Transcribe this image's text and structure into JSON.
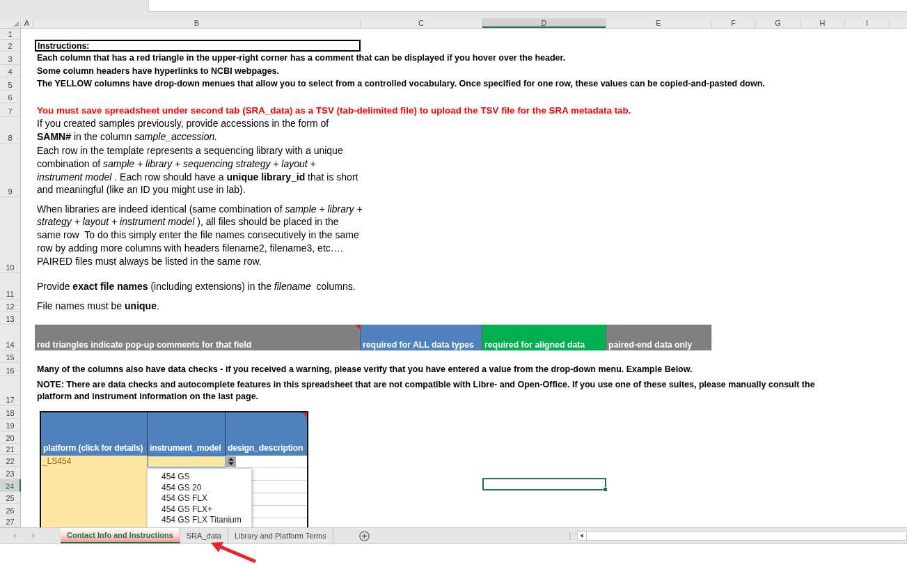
{
  "column_headers": [
    {
      "label": "A",
      "selected": false
    },
    {
      "label": "B",
      "selected": false
    },
    {
      "label": "C",
      "selected": false
    },
    {
      "label": "D",
      "selected": true
    },
    {
      "label": "E",
      "selected": false
    },
    {
      "label": "F",
      "selected": false
    },
    {
      "label": "G",
      "selected": false
    },
    {
      "label": "H",
      "selected": false
    },
    {
      "label": "I",
      "selected": false
    }
  ],
  "row_headers": [
    {
      "label": "1",
      "selected": false
    },
    {
      "label": "2",
      "selected": false
    },
    {
      "label": "3",
      "selected": false
    },
    {
      "label": "4",
      "selected": false
    },
    {
      "label": "5",
      "selected": false
    },
    {
      "label": "6",
      "selected": false
    },
    {
      "label": "7",
      "selected": false
    },
    {
      "label": "8",
      "selected": false
    },
    {
      "label": "9",
      "selected": false
    },
    {
      "label": "10",
      "selected": false
    },
    {
      "label": "11",
      "selected": false
    },
    {
      "label": "12",
      "selected": false
    },
    {
      "label": "13",
      "selected": false
    },
    {
      "label": "14",
      "selected": false
    },
    {
      "label": "15",
      "selected": false
    },
    {
      "label": "16",
      "selected": false
    },
    {
      "label": "17",
      "selected": false
    },
    {
      "label": "18",
      "selected": false
    },
    {
      "label": "19",
      "selected": false
    },
    {
      "label": "20",
      "selected": false
    },
    {
      "label": "21",
      "selected": false
    },
    {
      "label": "22",
      "selected": false
    },
    {
      "label": "23",
      "selected": false
    },
    {
      "label": "24",
      "selected": true
    },
    {
      "label": "25",
      "selected": false
    },
    {
      "label": "26",
      "selected": false
    },
    {
      "label": "27",
      "selected": false
    }
  ],
  "instructions": {
    "title": "Instructions:",
    "notes": [
      "Each column that has a red triangle in the upper-right corner has a comment that can be displayed if you hover over the header.",
      "Some column headers have hyperlinks to NCBI webpages.",
      "The YELLOW columns have drop-down menues that allow you to select from a controlled vocabulary. Once specified for one row, these values can be copied-and-pasted down."
    ],
    "warning": "You must save spreadsheet under second tab (SRA_data) as a TSV (tab-delimited file) to upload the TSV file for the SRA metadata tab.",
    "paragraphs": [
      "If you created samples previously, provide accessions in the form of **SAMN#** in the column *sample_accession.*",
      "Each row in the template represents a sequencing library with a unique combination of *sample + library + sequencing strategy + layout + instrument model* . Each row should have a **unique library_id** that is short and meaningful (like an ID you might use in lab).",
      "When libraries are indeed identical (same combination of *sample + library + strategy + layout + instrument model* ), all files should be placed in the same row  To do this simply enter the file names consecutively in the same row by adding more columns with headers filename2, filename3, etc…. PAIRED files must always be listed in the same row.",
      "Provide **exact file names** (including extensions) in the *filename*  columns.",
      "File names must be **unique**."
    ]
  },
  "legend": [
    {
      "text": "red triangles indicate pop-up comments for that field",
      "color": "#808080",
      "comment": true
    },
    {
      "text": "required for ALL data types",
      "color": "#4f81bd",
      "comment": false
    },
    {
      "text": "required for aligned data",
      "color": "#00b050",
      "comment": false
    },
    {
      "text": "paired-end data only",
      "color": "#808080",
      "comment": false
    }
  ],
  "notes_below": [
    "Many of the columns also have data checks - if you received a warning, please verify that you have entered a value from the drop-down menu. Example Below.",
    "NOTE: There are data checks and autocomplete features in this spreadsheet that are not compatible with Libre- and Open-Office. If you use one of these suites, please manually consult the platform and instrument information on the last page."
  ],
  "example": {
    "columns": [
      {
        "label": "platform (click for details)",
        "comment": false
      },
      {
        "label": "instrument_model",
        "comment": false
      },
      {
        "label": "design_description",
        "comment": true
      }
    ],
    "platform_value": "_LS454",
    "dropdown_items": [
      "454 GS",
      "454 GS 20",
      "454 GS FLX",
      "454 GS FLX+",
      "454 GS FLX Titanium"
    ]
  },
  "sheet_tabs": [
    {
      "label": "Contact Info and Instructions",
      "selected": true
    },
    {
      "label": "SRA_data",
      "selected": false
    },
    {
      "label": "Library and Platform Terms",
      "selected": false
    }
  ]
}
